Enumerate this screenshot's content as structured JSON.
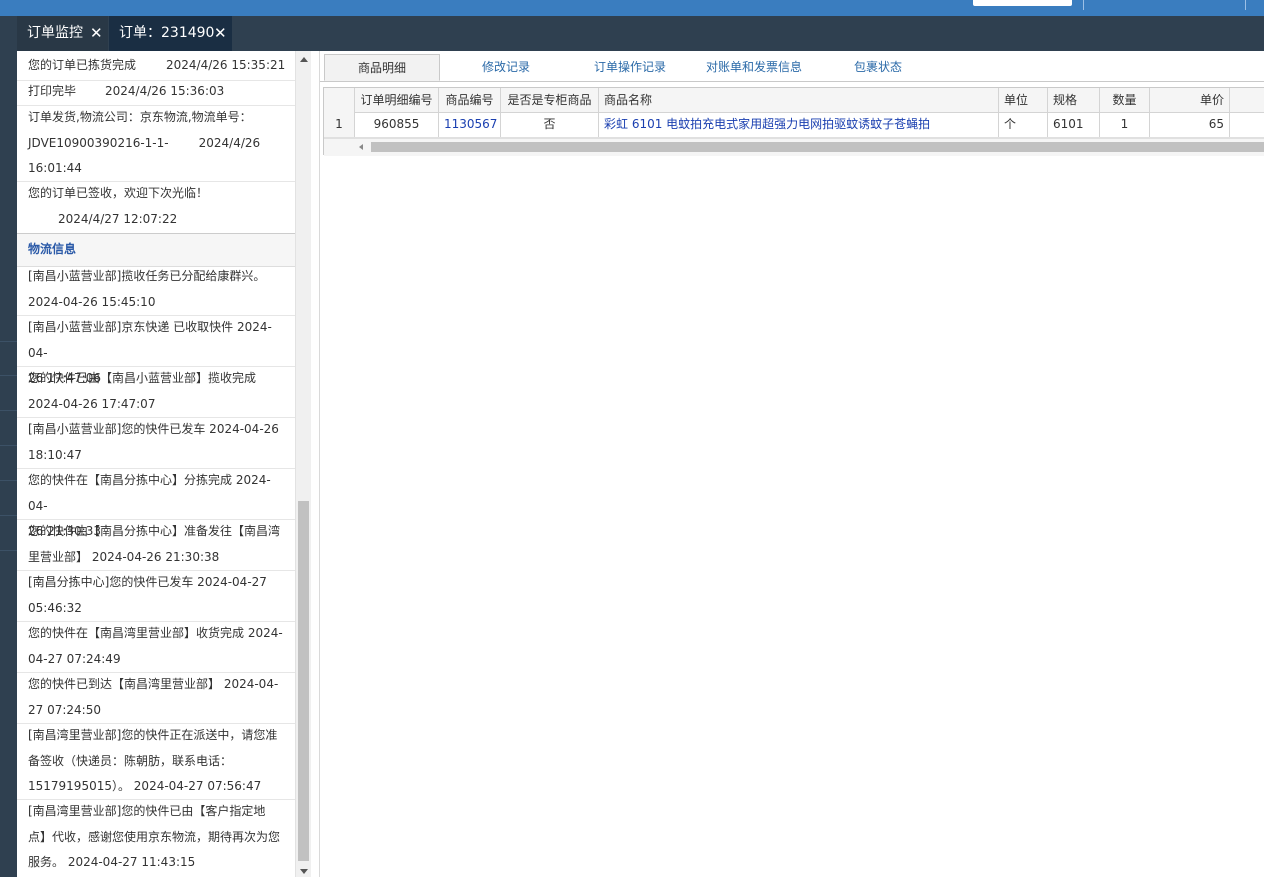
{
  "tabs": [
    {
      "label": "订单监控"
    },
    {
      "label": "订单：231490"
    }
  ],
  "close_glyph": "✕",
  "order_log": [
    {
      "text": "您的订单已拣货完成",
      "time": "2024/4/26 15:35:21"
    },
    {
      "text": "打印完毕",
      "time": "2024/4/26 15:36:03"
    },
    {
      "line1": "订单发货,物流公司：京东物流,物流单号：",
      "line2a": "JDVE10900390216-1-1-",
      "line2b": "2024/4/26",
      "line3": "16:01:44"
    },
    {
      "text": "您的订单已签收，欢迎下次光临！",
      "time": "2024/4/27 12:07:22"
    }
  ],
  "logistics_title": "物流信息",
  "logistics": [
    {
      "line1": "[南昌小蓝营业部]揽收任务已分配给康群兴。",
      "line2": "2024-04-26 15:45:10"
    },
    {
      "line1": "[南昌小蓝营业部]京东快递 已收取快件 2024-04-",
      "line2": "26 17:47:06"
    },
    {
      "line1": "您的快件已由【南昌小蓝营业部】揽收完成",
      "line2": "2024-04-26 17:47:07"
    },
    {
      "line1": "[南昌小蓝营业部]您的快件已发车 2024-04-26",
      "line2": "18:10:47"
    },
    {
      "line1": "您的快件在【南昌分拣中心】分拣完成 2024-04-",
      "line2": "26 21:30:33"
    },
    {
      "line1": "您的快件由【南昌分拣中心】准备发往【南昌湾",
      "line2": "里营业部】 2024-04-26 21:30:38"
    },
    {
      "line1": "[南昌分拣中心]您的快件已发车 2024-04-27",
      "line2": "05:46:32"
    },
    {
      "line1": "您的快件在【南昌湾里营业部】收货完成 2024-",
      "line2": "04-27 07:24:49"
    },
    {
      "line1": "您的快件已到达【南昌湾里营业部】 2024-04-",
      "line2": "27 07:24:50"
    },
    {
      "line1": "[南昌湾里营业部]您的快件正在派送中，请您准",
      "line2": "备签收（快递员：陈朝肪，联系电话：",
      "line3": "15179195015）。 2024-04-27 07:56:47"
    },
    {
      "line1": "[南昌湾里营业部]您的快件已由【客户指定地",
      "line2": "点】代收，感谢您使用京东物流，期待再次为您",
      "line3": "服务。 2024-04-27 11:43:15"
    }
  ],
  "detail_tabs": [
    {
      "label": "商品明细"
    },
    {
      "label": "修改记录"
    },
    {
      "label": "订单操作记录"
    },
    {
      "label": "对账单和发票信息"
    },
    {
      "label": "包裹状态"
    }
  ],
  "grid": {
    "columns": [
      "订单明细编号",
      "商品编号",
      "是否是专柜商品",
      "商品名称",
      "单位",
      "规格",
      "数量",
      "单价"
    ],
    "rows": [
      {
        "rownum": "1",
        "detail_id": "960855",
        "product_id": "1130567",
        "is_counter": "否",
        "name": "彩虹 6101 电蚊拍充电式家用超强力电网拍驱蚊诱蚊子苍蝇拍",
        "unit": "个",
        "spec": "6101",
        "qty": "1",
        "price": "65"
      }
    ]
  }
}
